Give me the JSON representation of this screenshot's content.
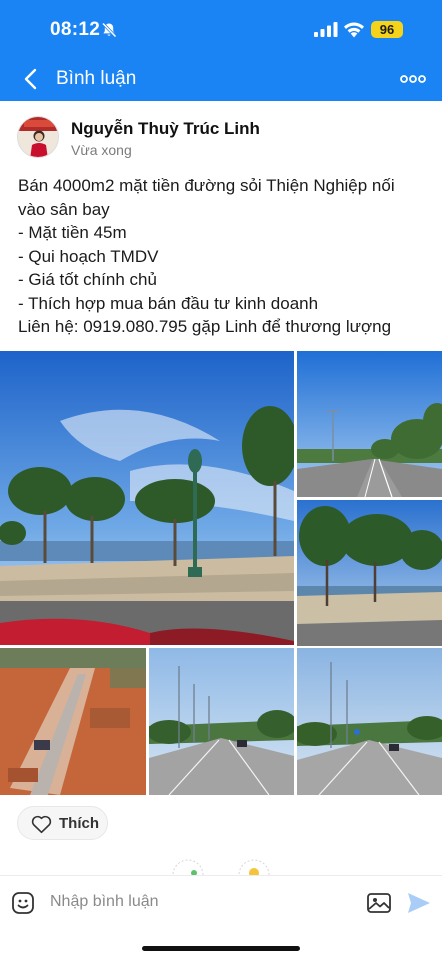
{
  "status_bar": {
    "time": "08:12",
    "battery": "96",
    "icons": [
      "bell-slash-icon",
      "signal-icon",
      "wifi-icon",
      "battery-icon"
    ]
  },
  "nav": {
    "title": "Bình luận",
    "back_icon": "chevron-left-icon",
    "more_icon": "more-horizontal-icon"
  },
  "post": {
    "author": "Nguyễn Thuỳ Trúc Linh",
    "time": "Vừa xong",
    "lines": [
      "Bán 4000m2 mặt tiền đường sỏi Thiện Nghiệp nối",
      "vào sân bay",
      "- Mặt tiền 45m",
      "- Qui hoạch TMDV",
      "- Giá tốt chính chủ",
      "- Thích hợp mua bán đầu tư kinh doanh",
      "Liên hệ: 0919.080.795 gặp Linh để thương lượng"
    ],
    "photo_count": 6
  },
  "actions": {
    "like_label": "Thích",
    "like_icon": "heart-icon"
  },
  "composer": {
    "placeholder": "Nhập bình luận",
    "icons": [
      "sticker-icon",
      "image-icon",
      "send-icon"
    ]
  },
  "colors": {
    "brand": "#1a84f5",
    "battery": "#f4d31a",
    "send": "#a9cdf7"
  }
}
